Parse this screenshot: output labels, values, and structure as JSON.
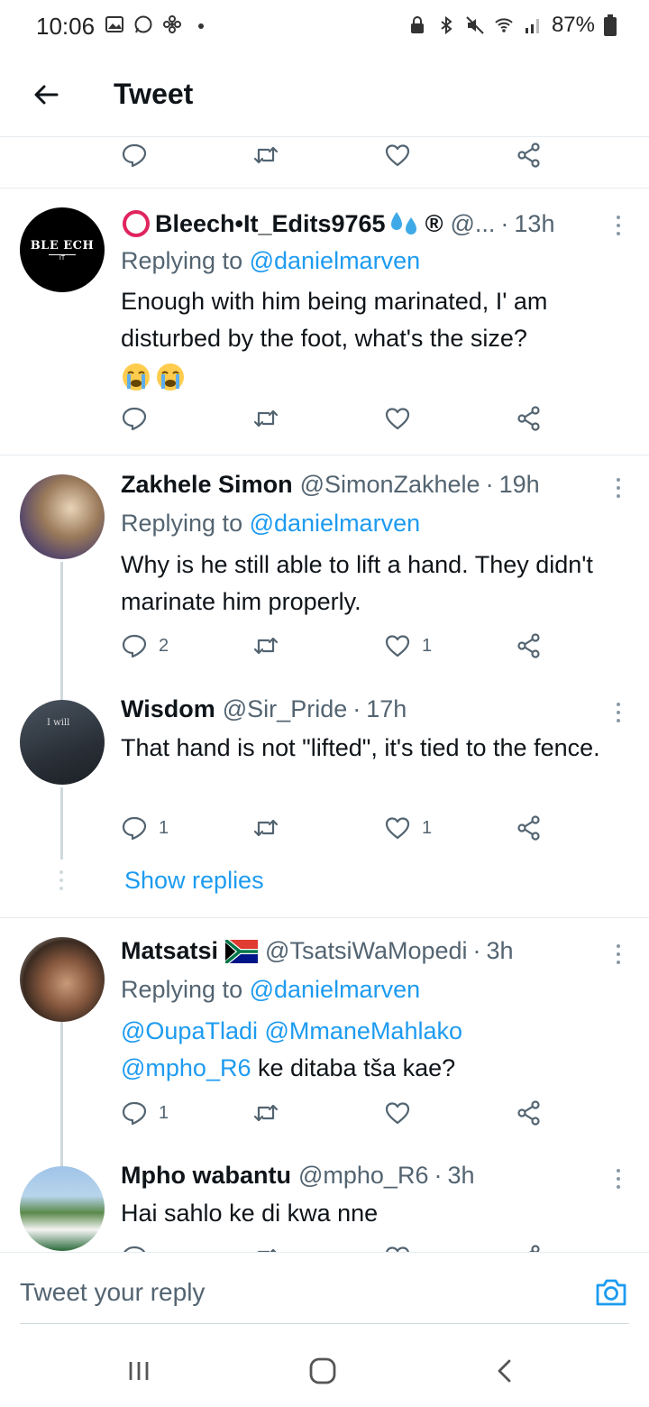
{
  "status_bar": {
    "time": "10:06",
    "battery": "87%"
  },
  "header": {
    "title": "Tweet"
  },
  "tweets": [
    {
      "name": "Bleech•It_Edits9765",
      "name_suffix": "®",
      "handle": "@...",
      "time": "13h",
      "replying_prefix": "Replying to ",
      "replying_to": "@danielmarven",
      "text": "Enough with him being marinated,  I' am disturbed by the foot,  what's  the size?",
      "avatar_text": "BLE ECH",
      "avatar_subtext": "IT"
    },
    {
      "name": "Zakhele Simon",
      "handle": "@SimonZakhele",
      "time": "19h",
      "replying_prefix": "Replying to ",
      "replying_to": "@danielmarven",
      "text": "Why is he still able to lift a hand. They didn't marinate him properly.",
      "reply_count": "2",
      "like_count": "1"
    },
    {
      "name": "Wisdom",
      "handle": "@Sir_Pride",
      "time": "17h",
      "text": "That hand is not \"lifted\", it's tied to the fence.",
      "reply_count": "1",
      "like_count": "1",
      "avatar_text": "I will"
    },
    {
      "name": "Matsatsi",
      "handle": "@TsatsiWaMopedi",
      "time": "3h",
      "replying_prefix": "Replying to ",
      "replying_to": "@danielmarven",
      "mention_1": "@OupaTladi",
      "mention_2": "@MmaneMahlako",
      "mention_3": "@mpho_R6",
      "text": " ke ditaba tša kae?",
      "reply_count": "1"
    },
    {
      "name": "Mpho wabantu",
      "handle": "@mpho_R6",
      "time": "3h",
      "text": "Hai sahlo ke di kwa nne"
    }
  ],
  "show_replies": "Show replies",
  "reply_box": {
    "placeholder": "Tweet your reply"
  },
  "colors": {
    "accent": "#1d9bf0",
    "secondary_text": "#536471",
    "divider": "#e6ecf0"
  }
}
